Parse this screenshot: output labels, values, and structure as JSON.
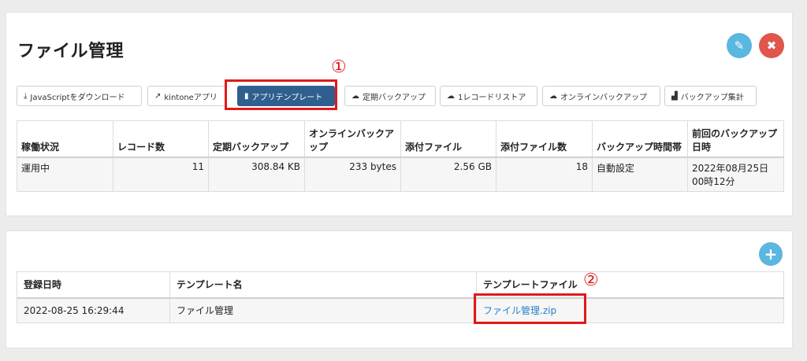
{
  "title": "ファイル管理",
  "toolbar": [
    {
      "icon": "download-icon",
      "glyph": "⤓",
      "label": "JavaScriptをダウンロード"
    },
    {
      "icon": "external-link-icon",
      "glyph": "↗",
      "label": "kintoneアプリ"
    },
    {
      "icon": "file-icon",
      "glyph": "▮",
      "label": "アプリテンプレート"
    },
    {
      "icon": "cloud-icon",
      "glyph": "☁",
      "label": "定期バックアップ"
    },
    {
      "icon": "cloud-icon",
      "glyph": "☁",
      "label": "1レコードリストア"
    },
    {
      "icon": "cloud-icon",
      "glyph": "☁",
      "label": "オンラインバックアップ"
    },
    {
      "icon": "bar-chart-icon",
      "glyph": "▟",
      "label": "バックアップ集計"
    }
  ],
  "status_table": {
    "headers": [
      "稼働状況",
      "レコード数",
      "定期バックアップ",
      "オンラインバックアップ",
      "添付ファイル",
      "添付ファイル数",
      "バックアップ時間帯",
      "前回のバックアップ日時"
    ],
    "row": [
      "運用中",
      "11",
      "308.84 KB",
      "233 bytes",
      "2.56 GB",
      "18",
      "自動設定",
      "2022年08月25日00時12分"
    ]
  },
  "template_table": {
    "headers": [
      "登録日時",
      "テンプレート名",
      "テンプレートファイル"
    ],
    "row": {
      "date": "2022-08-25 16:29:44",
      "name": "ファイル管理",
      "file": "ファイル管理.zip"
    }
  },
  "callouts": [
    "①",
    "②"
  ],
  "colors": {
    "primary": "#2f5f8f",
    "edit": "#5bb6e0",
    "delete": "#e0564a",
    "callout": "#e01a1a",
    "link": "#2a7ec8"
  }
}
